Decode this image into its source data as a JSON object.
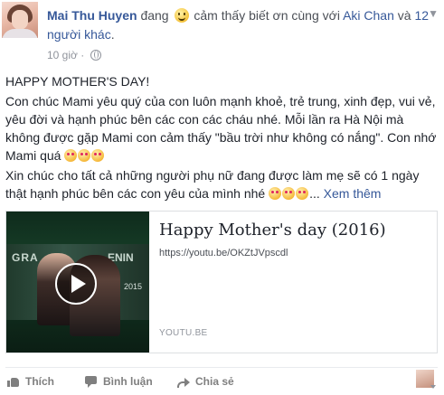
{
  "post": {
    "author": "Mai Thu Huyen",
    "activity_pre": "đang",
    "activity_text": "cảm thấy biết ơn cùng với",
    "tagged_person": "Aki Chan",
    "tagged_and": "và",
    "tagged_others": "12 người khác",
    "tagged_end": ".",
    "time": "10 giờ",
    "privacy_icon": "globe-icon",
    "menu_icon": "chevron-down-icon",
    "line1": "HAPPY MOTHER'S DAY!",
    "para1": "Con chúc Mami yêu quý của con luôn mạnh khoẻ, trẻ trung, xinh đẹp, vui vẻ, yêu đời và hạnh phúc bên các con các cháu nhé. Mỗi lần ra Hà Nội mà không được gặp Mami con cảm thấy \"bầu trời như không có nắng\". Con nhớ Mami quá",
    "para2": "Xin chúc cho tất cả những người phụ nữ đang được làm mẹ sẽ có 1 ngày thật hạnh phúc bên các con yêu của mình nhé",
    "see_more": "Xem thêm",
    "see_more_prefix": "...",
    "emoji_icon": "kiss-emoji-icon"
  },
  "link_card": {
    "title": "Happy Mother's day (2016)",
    "url": "https://youtu.be/OKZtJVpscdl",
    "domain": "YOUTU.BE",
    "thumb_text_left": "GRA",
    "thumb_text_right": "ENIN",
    "thumb_year": "2015"
  },
  "actions": {
    "like": "Thích",
    "comment": "Bình luận",
    "share": "Chia sẻ"
  }
}
